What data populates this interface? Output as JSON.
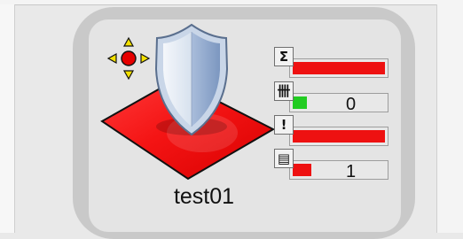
{
  "node": {
    "label": "test01",
    "shield_icon": "shield-icon",
    "move_icon": "move-arrows-icon",
    "base_color": "#ee1111"
  },
  "indicators": [
    {
      "name": "sum",
      "icon": "sigma-icon",
      "glyph": "Σ",
      "value": "",
      "color": "#ee1111",
      "level": 1.0
    },
    {
      "name": "count",
      "icon": "tally-icon",
      "glyph": "卌",
      "value": "0",
      "color": "#22cc22",
      "level": 0.15
    },
    {
      "name": "alert",
      "icon": "exclamation-icon",
      "glyph": "!",
      "value": "",
      "color": "#ee1111",
      "level": 1.0
    },
    {
      "name": "queue",
      "icon": "queue-icon",
      "glyph": "▤",
      "value": "1",
      "color": "#ee1111",
      "level": 0.2
    }
  ]
}
